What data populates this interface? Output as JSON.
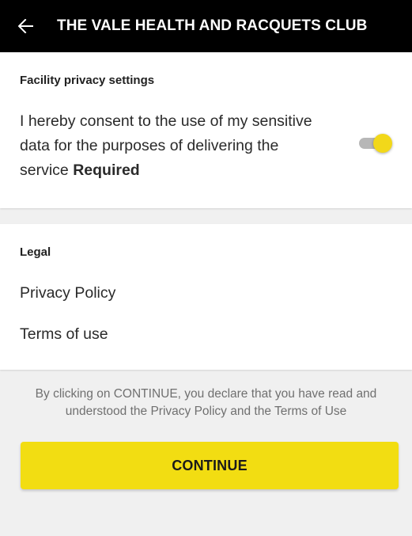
{
  "app_bar": {
    "back_icon": "arrow-left-icon",
    "title": "THE VALE HEALTH AND RACQUETS CLUB"
  },
  "privacy_section": {
    "title": "Facility privacy settings",
    "consent_text": "I hereby consent to the use of my sensitive data for the purposes of delivering the service",
    "required_label": "Required",
    "consent_toggle_on": true
  },
  "legal_section": {
    "title": "Legal",
    "privacy_policy_label": "Privacy Policy",
    "terms_label": "Terms of use"
  },
  "footer": {
    "declaration": "By clicking on CONTINUE, you declare that you have read and understood the Privacy Policy and the Terms of Use",
    "continue_label": "CONTINUE"
  },
  "colors": {
    "app_bar_bg": "#000000",
    "accent_yellow": "#f2dd12",
    "page_bg": "#f0f0f0"
  }
}
